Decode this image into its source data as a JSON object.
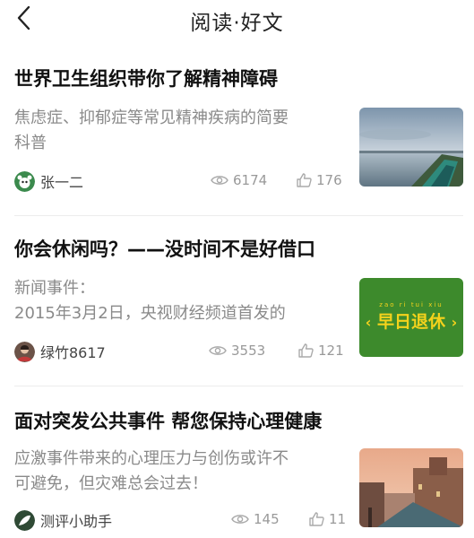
{
  "header": {
    "title": "阅读·好文"
  },
  "articles": [
    {
      "title": "世界卫生组织带你了解精神障碍",
      "summary_lines": [
        "焦虑症、抑郁症等常见精神疾病的简要",
        "科普"
      ],
      "author": "张一二",
      "views": "6174",
      "likes": "176",
      "thumb": "lake-boat-photo"
    },
    {
      "title": "你会休闲吗？——没时间不是好借口",
      "summary_lines": [
        "新闻事件：",
        "2015年3月2日，央视财经频道首发的"
      ],
      "author": "绿竹8617",
      "views": "3553",
      "likes": "121",
      "thumb": {
        "pinyin": [
          "zao",
          "ri",
          "tui",
          "xiu"
        ],
        "text": "早日退休",
        "bg": "#3d8a2c",
        "fg": "#f4d21c"
      }
    },
    {
      "title": "面对突发公共事件 帮您保持心理健康",
      "summary_lines": [
        "应激事件带来的心理压力与创伤或许不",
        "可避免，但灾难总会过去！"
      ],
      "author": "测评小助手",
      "views": "145",
      "likes": "11",
      "thumb": "canal-city-photo"
    }
  ],
  "colors": {
    "title": "#111111",
    "summary": "#8a8a8a",
    "meta": "#999999",
    "divider": "#ececec"
  }
}
